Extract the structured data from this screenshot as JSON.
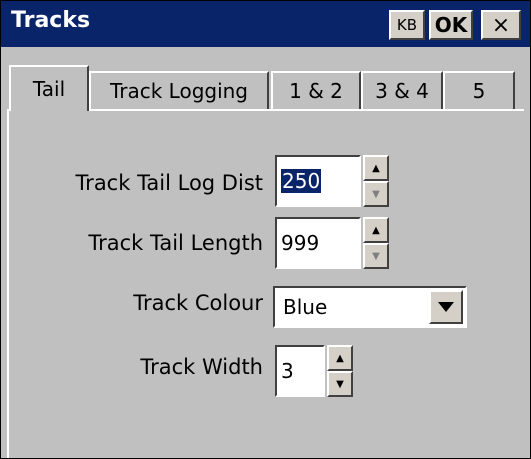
{
  "window": {
    "title": "Tracks"
  },
  "titlebar": {
    "kb_label": "KB",
    "ok_label": "OK",
    "close_label": "×"
  },
  "tabs": [
    {
      "label": "Tail",
      "active": true
    },
    {
      "label": "Track Logging",
      "active": false
    },
    {
      "label": "1 & 2",
      "active": false
    },
    {
      "label": "3 & 4",
      "active": false
    },
    {
      "label": "5",
      "active": false
    }
  ],
  "form": {
    "tail_log_dist": {
      "label": "Track Tail Log Dist",
      "value": "250"
    },
    "tail_length": {
      "label": "Track Tail Length",
      "value": "999"
    },
    "colour": {
      "label": "Track Colour",
      "value": "Blue"
    },
    "width": {
      "label": "Track Width",
      "value": "3"
    }
  },
  "colors": {
    "titlebar": "#0a246a",
    "face": "#c0c0c0",
    "selection": "#0a246a"
  }
}
